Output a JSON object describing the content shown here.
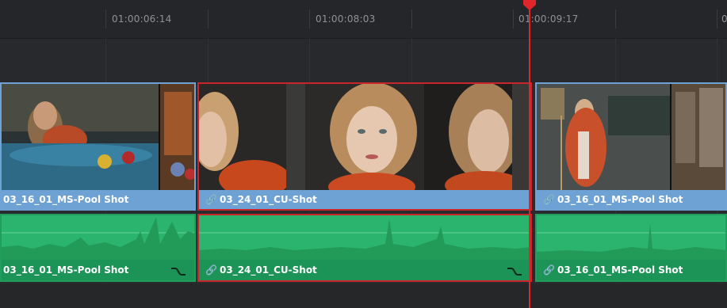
{
  "ruler": {
    "timecodes": [
      "01:00:06:14",
      "01:00:08:03",
      "01:00:09:17",
      "0"
    ]
  },
  "tracks": {
    "video": [
      {
        "name": "03_16_01_MS-Pool Shot",
        "linked": false,
        "selected": false
      },
      {
        "name": "03_24_01_CU-Shot",
        "linked": true,
        "selected": true
      },
      {
        "name": "03_16_01_MS-Pool Shot",
        "linked": true,
        "selected": false
      }
    ],
    "audio": [
      {
        "name": "03_16_01_MS-Pool Shot",
        "linked": false,
        "selected": false
      },
      {
        "name": "03_24_01_CU-Shot",
        "linked": true,
        "selected": true
      },
      {
        "name": "03_16_01_MS-Pool Shot",
        "linked": true,
        "selected": false
      }
    ]
  },
  "icons": {
    "link": "link-icon",
    "curve": "volume-curve-icon",
    "playhead": "playhead-icon"
  },
  "colors": {
    "video_clip": "#6ea2d5",
    "audio_clip": "#2bb46e",
    "selection": "#c8262a",
    "playhead": "#e0262b"
  }
}
